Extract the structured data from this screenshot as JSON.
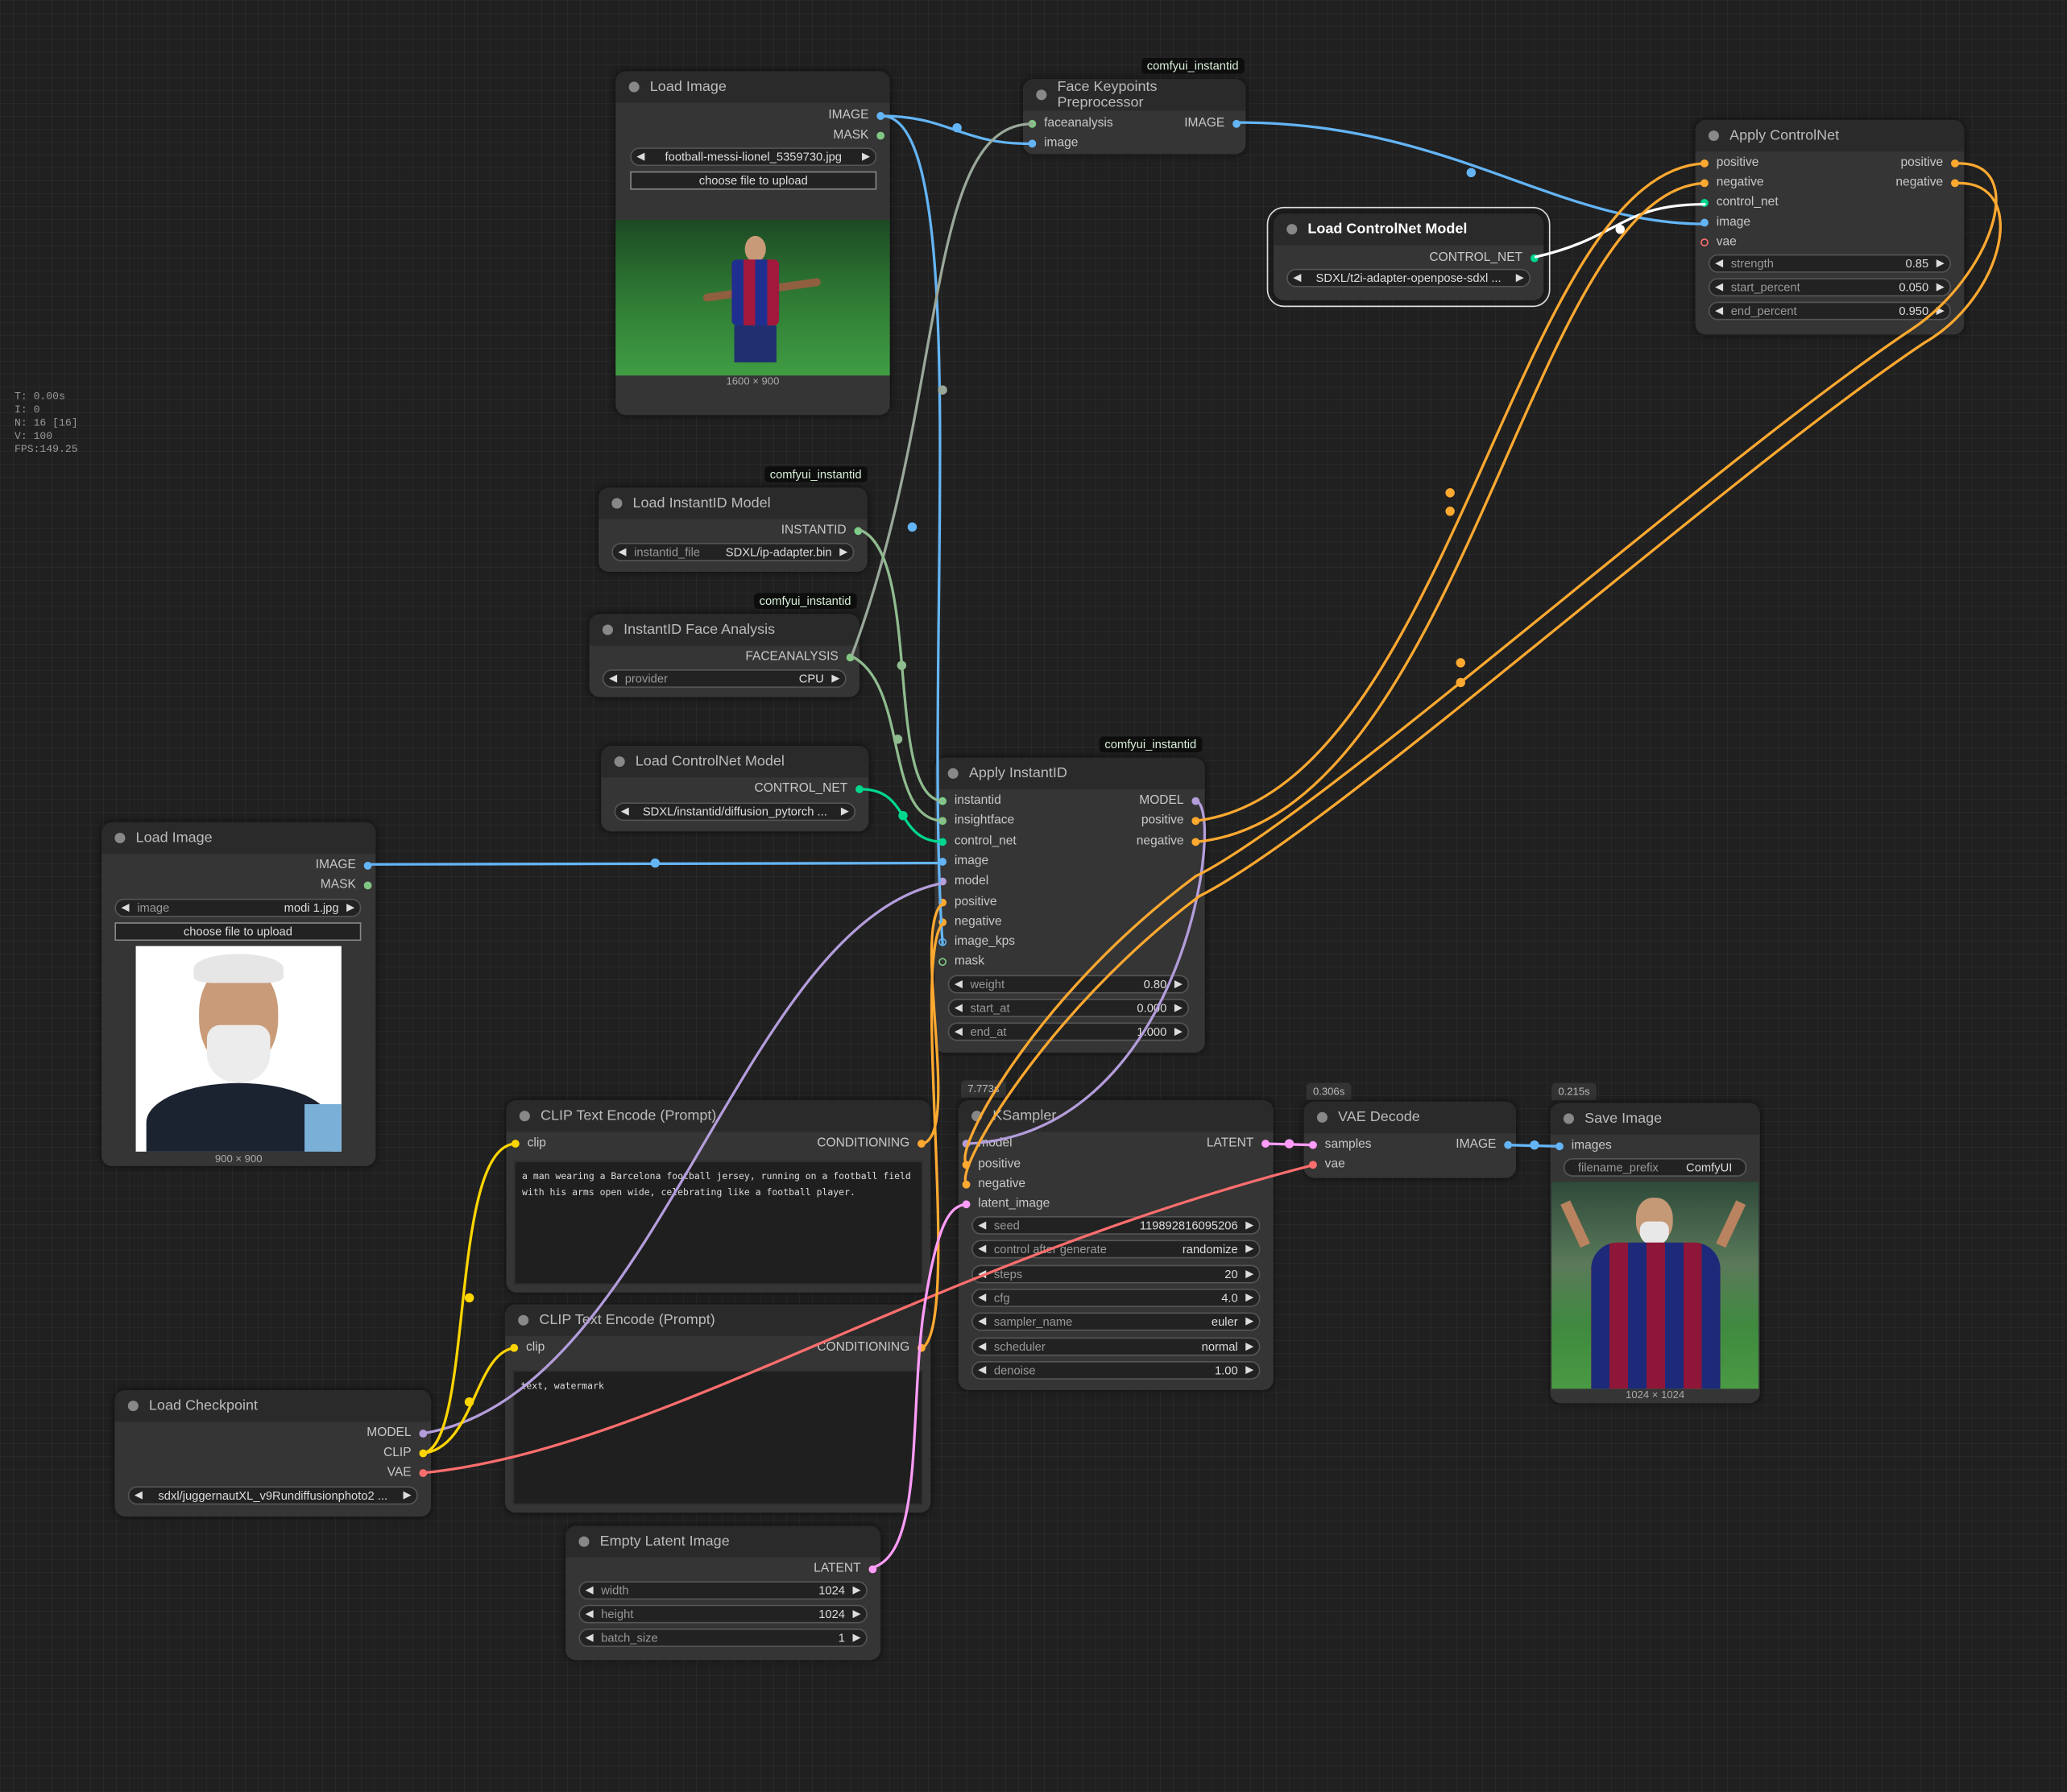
{
  "stats": {
    "t": "T: 0.00s",
    "i": "I: 0",
    "n": "N: 16 [16]",
    "v": "V: 100",
    "fps": "FPS:149.25"
  },
  "colors": {
    "background": "#202020",
    "node_body": "#353535",
    "node_title": "#2a2a2a",
    "image": "#64b5f6",
    "mask": "#81c784",
    "model": "#b39ddb",
    "clip": "#ffd500",
    "vae": "#ff6e6e",
    "conditioning": "#ffa931",
    "latent": "#ff9cf9",
    "control_net": "#00d78d",
    "insightface": "#8fbc8f",
    "instantid": "#7ccf8a"
  },
  "badge_text": "comfyui_instantid",
  "nodes": {
    "load_image_1": {
      "title": "Load Image",
      "out_image": "IMAGE",
      "out_mask": "MASK",
      "file_value": "football-messi-lionel_5359730.jpg",
      "upload_label": "choose file to upload",
      "dims": "1600 × 900"
    },
    "face_keypoints": {
      "title": "Face Keypoints Preprocessor",
      "in_faceanalysis": "faceanalysis",
      "in_image": "image",
      "out_image": "IMAGE"
    },
    "apply_controlnet": {
      "title": "Apply ControlNet",
      "in_positive": "positive",
      "in_negative": "negative",
      "in_control_net": "control_net",
      "in_image": "image",
      "in_vae": "vae",
      "out_positive": "positive",
      "out_negative": "negative",
      "strength_label": "strength",
      "strength_value": "0.85",
      "start_label": "start_percent",
      "start_value": "0.050",
      "end_label": "end_percent",
      "end_value": "0.950"
    },
    "load_controlnet_sel": {
      "title": "Load ControlNet Model",
      "out_control_net": "CONTROL_NET",
      "model_value": "SDXL/t2i-adapter-openpose-sdxl ..."
    },
    "load_instantid": {
      "title": "Load InstantID Model",
      "out": "INSTANTID",
      "file_label": "instantid_file",
      "file_value": "SDXL/ip-adapter.bin"
    },
    "face_analysis": {
      "title": "InstantID Face Analysis",
      "out": "FACEANALYSIS",
      "provider_label": "provider",
      "provider_value": "CPU"
    },
    "load_controlnet_2": {
      "title": "Load ControlNet Model",
      "out": "CONTROL_NET",
      "model_value": "SDXL/instantid/diffusion_pytorch ..."
    },
    "apply_instantid": {
      "title": "Apply InstantID",
      "in_instantid": "instantid",
      "in_insightface": "insightface",
      "in_control_net": "control_net",
      "in_image": "image",
      "in_model": "model",
      "in_positive": "positive",
      "in_negative": "negative",
      "in_image_kps": "image_kps",
      "in_mask": "mask",
      "out_model": "MODEL",
      "out_positive": "positive",
      "out_negative": "negative",
      "weight_label": "weight",
      "weight_value": "0.80",
      "start_label": "start_at",
      "start_value": "0.000",
      "end_label": "end_at",
      "end_value": "1.000"
    },
    "load_image_2": {
      "title": "Load Image",
      "out_image": "IMAGE",
      "out_mask": "MASK",
      "image_label": "image",
      "file_value": "modi 1.jpg",
      "upload_label": "choose file to upload",
      "dims": "900 × 900"
    },
    "clip_pos": {
      "title": "CLIP Text Encode (Prompt)",
      "in_clip": "clip",
      "out": "CONDITIONING",
      "text": "a man wearing a Barcelona football jersey, running on a football field with his arms open wide, celebrating like a football player."
    },
    "clip_neg": {
      "title": "CLIP Text Encode (Prompt)",
      "in_clip": "clip",
      "out": "CONDITIONING",
      "text": "text, watermark"
    },
    "load_checkpoint": {
      "title": "Load Checkpoint",
      "out_model": "MODEL",
      "out_clip": "CLIP",
      "out_vae": "VAE",
      "ckpt_value": "sdxl/juggernautXL_v9Rundiffusionphoto2 ..."
    },
    "empty_latent": {
      "title": "Empty Latent Image",
      "out": "LATENT",
      "width_label": "width",
      "width_value": "1024",
      "height_label": "height",
      "height_value": "1024",
      "batch_label": "batch_size",
      "batch_value": "1"
    },
    "ksampler": {
      "title": "KSampler",
      "timing": "7.773s",
      "in_model": "model",
      "in_positive": "positive",
      "in_negative": "negative",
      "in_latent": "latent_image",
      "out": "LATENT",
      "seed_label": "seed",
      "seed_value": "119892816095206",
      "cag_label": "control after generate",
      "cag_value": "randomize",
      "steps_label": "steps",
      "steps_value": "20",
      "cfg_label": "cfg",
      "cfg_value": "4.0",
      "sampler_label": "sampler_name",
      "sampler_value": "euler",
      "scheduler_label": "scheduler",
      "scheduler_value": "normal",
      "denoise_label": "denoise",
      "denoise_value": "1.00"
    },
    "vae_decode": {
      "title": "VAE Decode",
      "timing": "0.306s",
      "in_samples": "samples",
      "in_vae": "vae",
      "out": "IMAGE"
    },
    "save_image": {
      "title": "Save Image",
      "timing": "0.215s",
      "in_images": "images",
      "prefix_label": "filename_prefix",
      "prefix_value": "ComfyUI",
      "dims": "1024 × 1024"
    }
  }
}
